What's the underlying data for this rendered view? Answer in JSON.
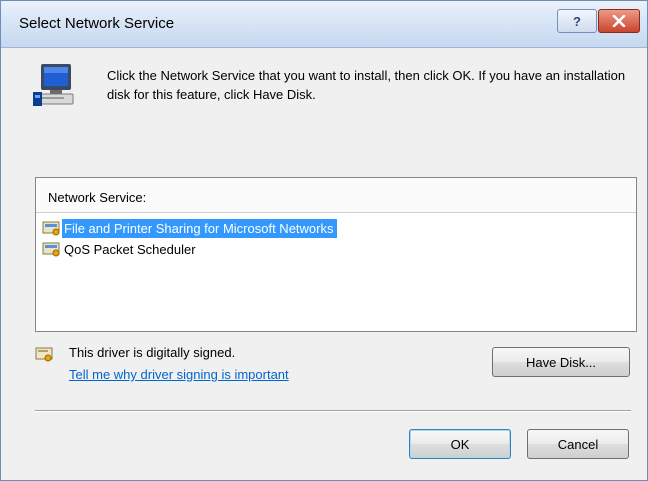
{
  "window": {
    "title": "Select Network Service",
    "help_glyph": "?",
    "close_icon": "close-icon"
  },
  "instructions": "Click the Network Service that you want to install, then click OK. If you have an installation disk for this feature, click Have Disk.",
  "list": {
    "header": "Network Service:",
    "items": [
      {
        "label": "File and Printer Sharing for Microsoft Networks",
        "selected": true,
        "icon": "network-service-icon"
      },
      {
        "label": "QoS Packet Scheduler",
        "selected": false,
        "icon": "network-service-icon"
      }
    ]
  },
  "driver": {
    "signed_text": "This driver is digitally signed.",
    "link_text": "Tell me why driver signing is important",
    "icon": "certificate-icon"
  },
  "buttons": {
    "have_disk": "Have Disk...",
    "ok": "OK",
    "cancel": "Cancel"
  },
  "colors": {
    "selection": "#3399ff",
    "link": "#0066cc",
    "close_button": "#c9452f"
  }
}
